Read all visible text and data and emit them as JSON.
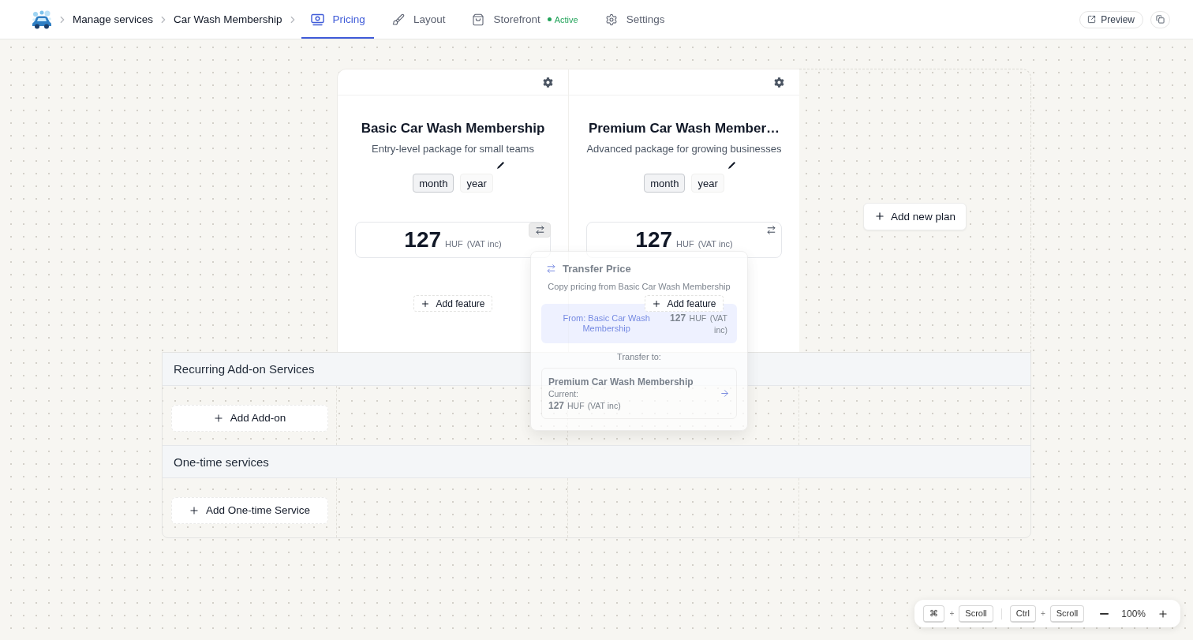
{
  "nav": {
    "breadcrumbs": [
      "Manage services",
      "Car Wash Membership"
    ],
    "tabs": [
      {
        "label": "Pricing",
        "selected": true
      },
      {
        "label": "Layout",
        "selected": false
      },
      {
        "label": "Storefront",
        "selected": false,
        "status": {
          "label": "Active",
          "color": "#22a35a"
        }
      },
      {
        "label": "Settings",
        "selected": false
      }
    ],
    "preview_label": "Preview"
  },
  "plans": [
    {
      "title": "Basic Car Wash Membership",
      "description": "Entry-level package for small teams",
      "periods": [
        {
          "label": "month",
          "selected": true
        },
        {
          "label": "year",
          "selected": false
        }
      ],
      "price": {
        "amount": "127",
        "currency": "HUF",
        "tax_note": "(VAT inc)"
      },
      "transfer_active": true,
      "add_feature_label": "Add feature"
    },
    {
      "title": "Premium Car Wash Member…",
      "description": "Advanced package for growing businesses",
      "periods": [
        {
          "label": "month",
          "selected": true
        },
        {
          "label": "year",
          "selected": false
        }
      ],
      "price": {
        "amount": "127",
        "currency": "HUF",
        "tax_note": "(VAT inc)"
      },
      "transfer_active": false,
      "add_feature_label": "Add feature"
    }
  ],
  "add_plan_label": "Add new plan",
  "transfer_popover": {
    "title": "Transfer Price",
    "subtitle": "Copy pricing from Basic Car Wash Membership",
    "source": {
      "label": "From: Basic Car Wash Membership",
      "amount": "127",
      "currency": "HUF",
      "tax_note": "(VAT inc)"
    },
    "target_heading": "Transfer to:",
    "targets": [
      {
        "name": "Premium Car Wash Membership",
        "current_label": "Current:",
        "amount": "127",
        "currency": "HUF",
        "tax_note": "(VAT inc)"
      }
    ]
  },
  "sections": [
    {
      "title": "Recurring Add-on Services",
      "add_label": "Add Add-on"
    },
    {
      "title": "One-time services",
      "add_label": "Add One-time Service"
    }
  ],
  "zoom_bar": {
    "shortcuts": [
      {
        "keys": [
          "⌘",
          "Scroll"
        ],
        "joiner": "+"
      },
      {
        "keys": [
          "Ctrl",
          "Scroll"
        ],
        "joiner": "+"
      }
    ],
    "zoom_level": "100%"
  }
}
